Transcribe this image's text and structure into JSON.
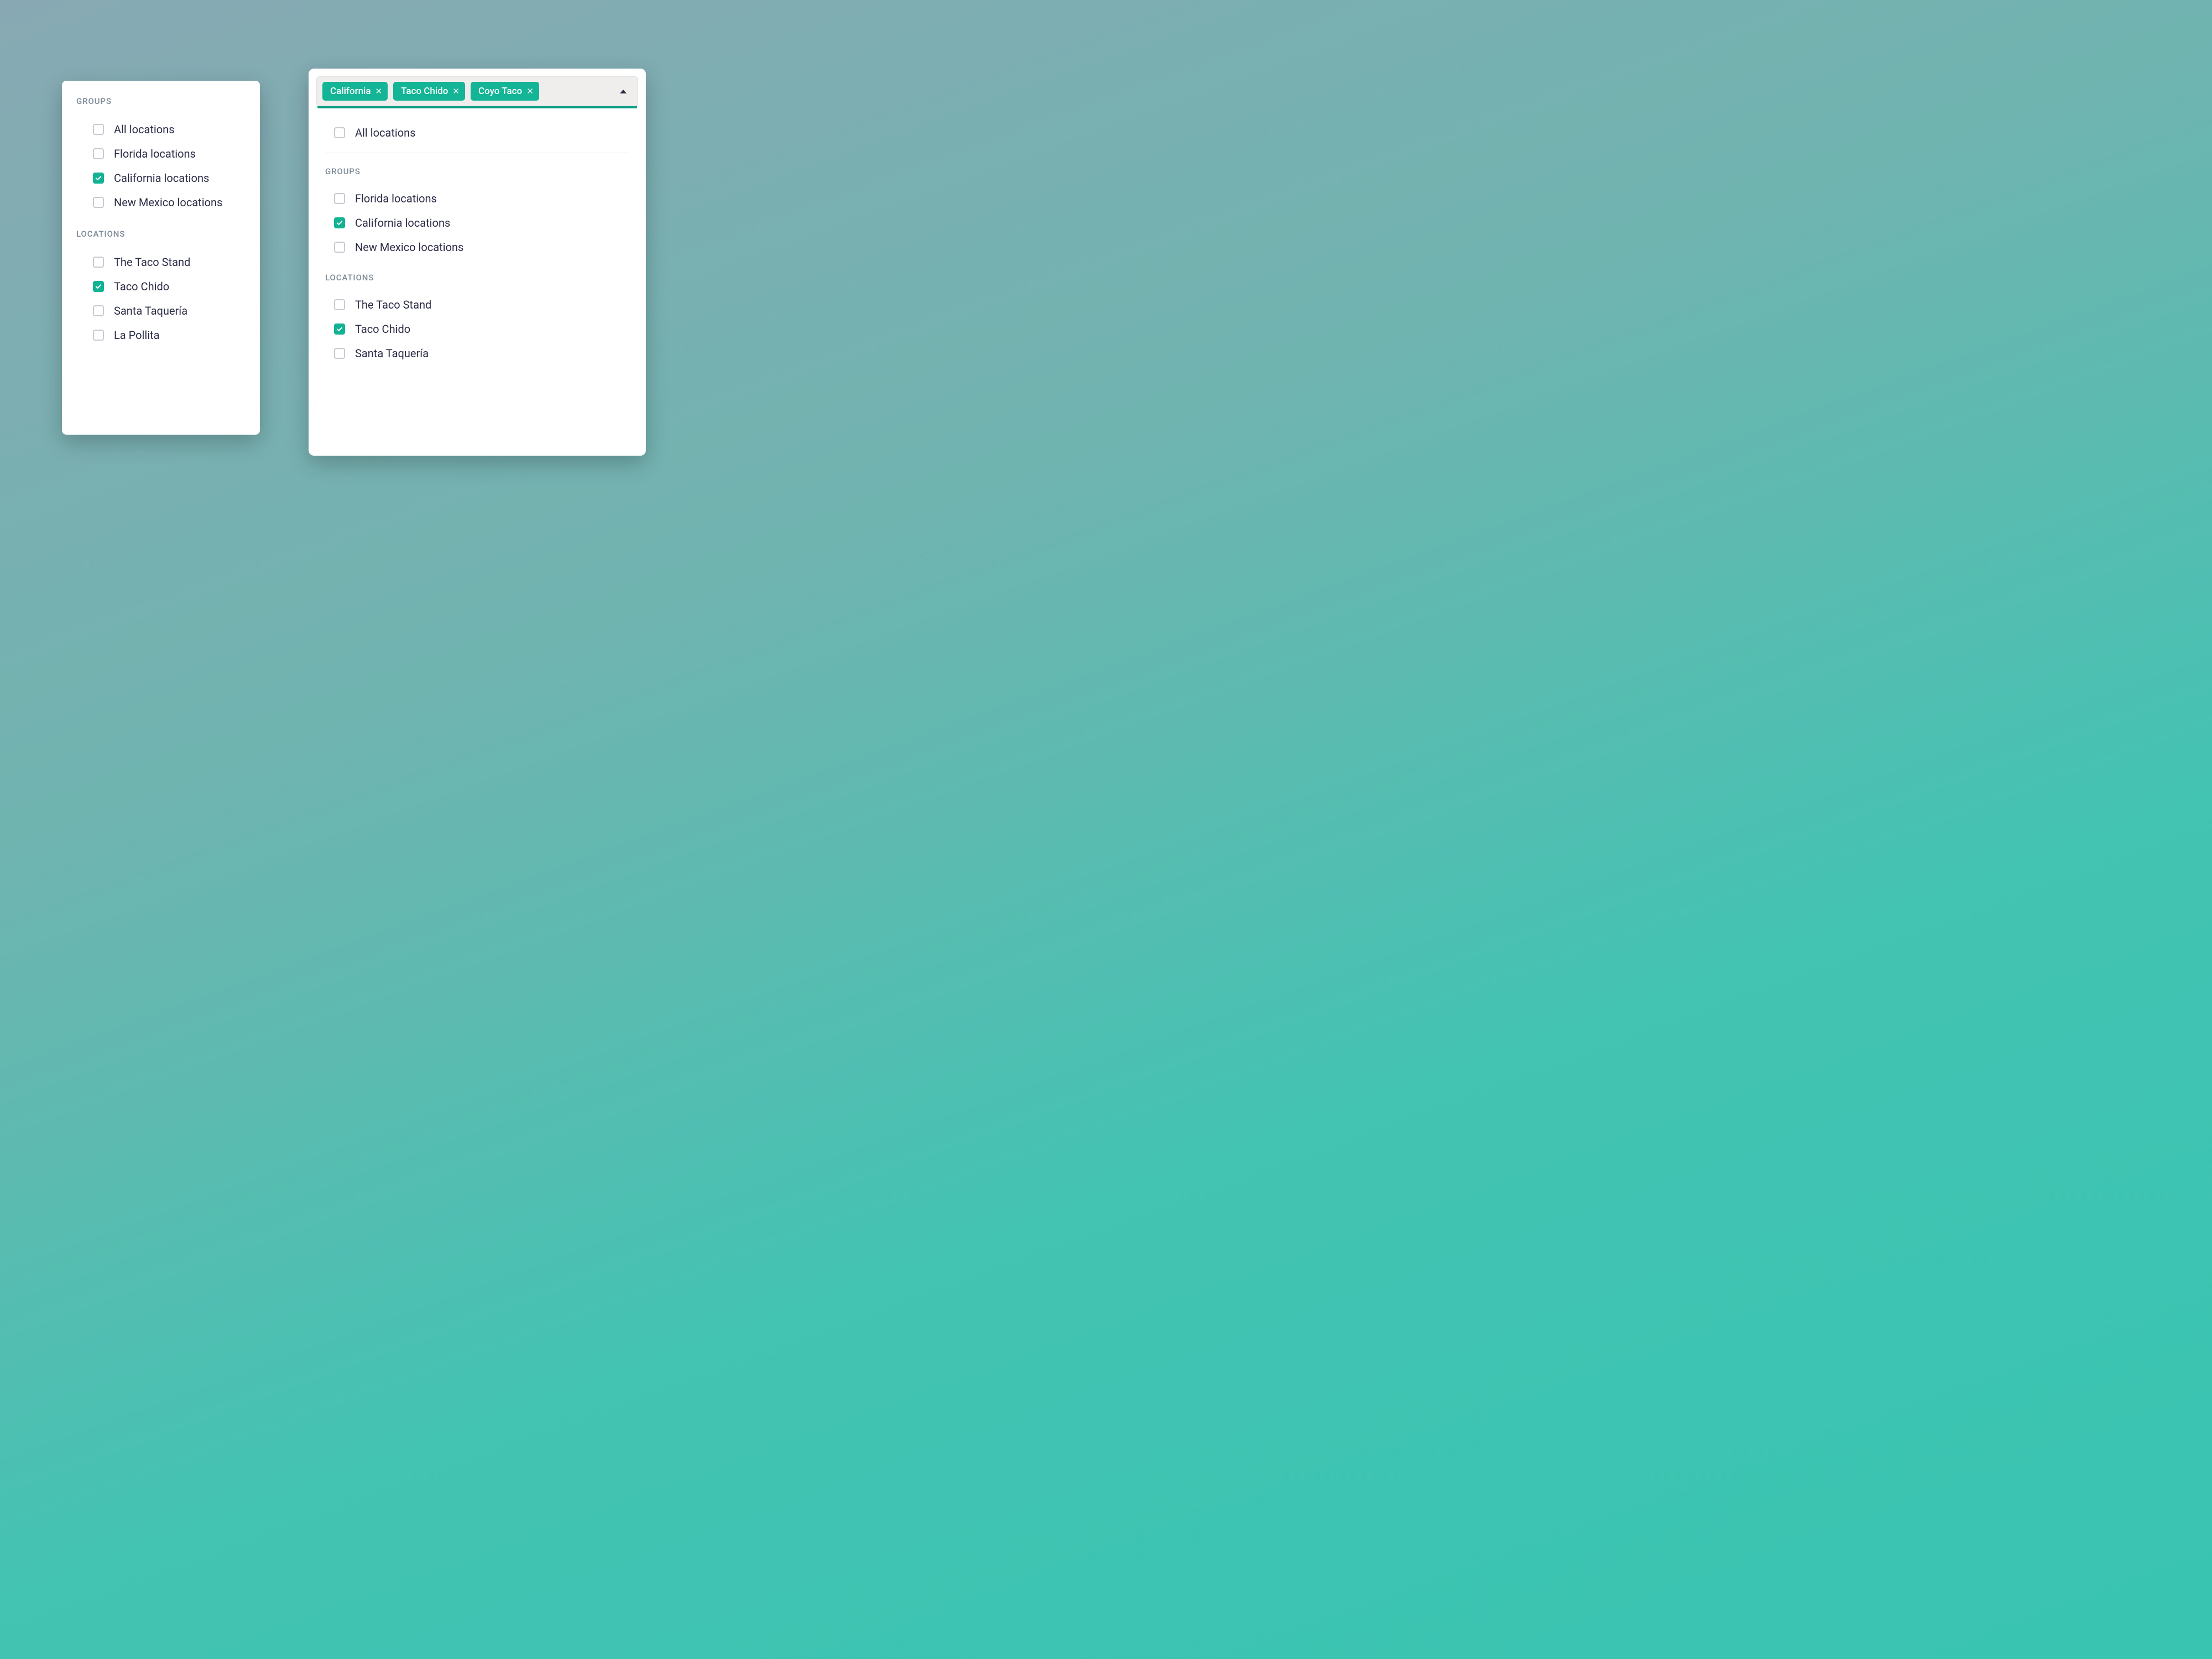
{
  "colors": {
    "accent": "#13b596",
    "accent_dark": "#0f9f86",
    "text": "#2a2c45",
    "muted": "#7d8a97",
    "checkbox_border": "#c5cbd3"
  },
  "left": {
    "groups_header": "GROUPS",
    "locations_header": "LOCATIONS",
    "groups": [
      {
        "label": "All locations",
        "checked": false
      },
      {
        "label": "Florida locations",
        "checked": false
      },
      {
        "label": "California locations",
        "checked": true
      },
      {
        "label": "New Mexico locations",
        "checked": false
      }
    ],
    "locations": [
      {
        "label": "The Taco Stand",
        "checked": false
      },
      {
        "label": "Taco Chido",
        "checked": true
      },
      {
        "label": "Santa Taquería",
        "checked": false
      },
      {
        "label": "La Pollita",
        "checked": false
      }
    ]
  },
  "right": {
    "chips": [
      {
        "label": "California"
      },
      {
        "label": "Taco Chido"
      },
      {
        "label": "Coyo Taco"
      }
    ],
    "all_label": "All locations",
    "all_checked": false,
    "groups_header": "GROUPS",
    "locations_header": "LOCATIONS",
    "groups": [
      {
        "label": "Florida locations",
        "checked": false
      },
      {
        "label": "California locations",
        "checked": true
      },
      {
        "label": "New Mexico locations",
        "checked": false
      }
    ],
    "locations": [
      {
        "label": "The Taco Stand",
        "checked": false
      },
      {
        "label": "Taco Chido",
        "checked": true
      },
      {
        "label": "Santa Taquería",
        "checked": false
      }
    ]
  }
}
